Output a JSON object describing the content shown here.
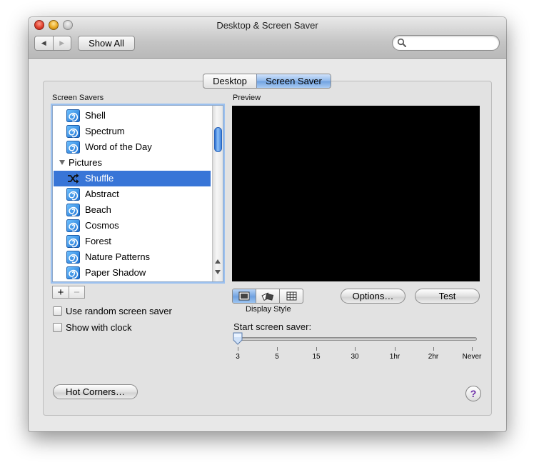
{
  "window": {
    "title": "Desktop & Screen Saver"
  },
  "toolbar": {
    "back_icon": "back-arrow-icon",
    "forward_icon": "forward-arrow-icon",
    "show_all_label": "Show All",
    "search": {
      "placeholder": "",
      "value": ""
    }
  },
  "tabs": [
    {
      "label": "Desktop",
      "selected": false
    },
    {
      "label": "Screen Saver",
      "selected": true
    }
  ],
  "screen_savers": {
    "title": "Screen Savers",
    "items": [
      {
        "label": "Shell",
        "type": "item",
        "icon": "screensaver-swirl-icon"
      },
      {
        "label": "Spectrum",
        "type": "item",
        "icon": "screensaver-swirl-icon"
      },
      {
        "label": "Word of the Day",
        "type": "item",
        "icon": "screensaver-swirl-icon"
      },
      {
        "label": "Pictures",
        "type": "group",
        "icon": "disclosure-triangle-icon"
      },
      {
        "label": "Shuffle",
        "type": "item",
        "icon": "shuffle-icon",
        "selected": true
      },
      {
        "label": "Abstract",
        "type": "item",
        "icon": "screensaver-swirl-icon"
      },
      {
        "label": "Beach",
        "type": "item",
        "icon": "screensaver-swirl-icon"
      },
      {
        "label": "Cosmos",
        "type": "item",
        "icon": "screensaver-swirl-icon"
      },
      {
        "label": "Forest",
        "type": "item",
        "icon": "screensaver-swirl-icon"
      },
      {
        "label": "Nature Patterns",
        "type": "item",
        "icon": "screensaver-swirl-icon"
      },
      {
        "label": "Paper Shadow",
        "type": "item",
        "icon": "screensaver-swirl-icon"
      }
    ],
    "add_label": "+",
    "remove_label": "−"
  },
  "options": {
    "random_label": "Use random screen saver",
    "random_checked": false,
    "clock_label": "Show with clock",
    "clock_checked": false
  },
  "preview": {
    "title": "Preview",
    "display_style_label": "Display Style",
    "display_styles": [
      "slideshow-icon",
      "collage-icon",
      "mosaic-icon"
    ],
    "display_style_selected": 0,
    "options_button": "Options…",
    "test_button": "Test"
  },
  "start": {
    "label": "Start screen saver:",
    "ticks": [
      "3",
      "5",
      "15",
      "30",
      "1hr",
      "2hr",
      "Never"
    ],
    "selected": "3"
  },
  "hot_corners_label": "Hot Corners…",
  "help_label": "?",
  "colors": {
    "selection": "#3875d7",
    "focus_ring": "#9cc1ef",
    "help_glyph": "#6a2aa6"
  }
}
